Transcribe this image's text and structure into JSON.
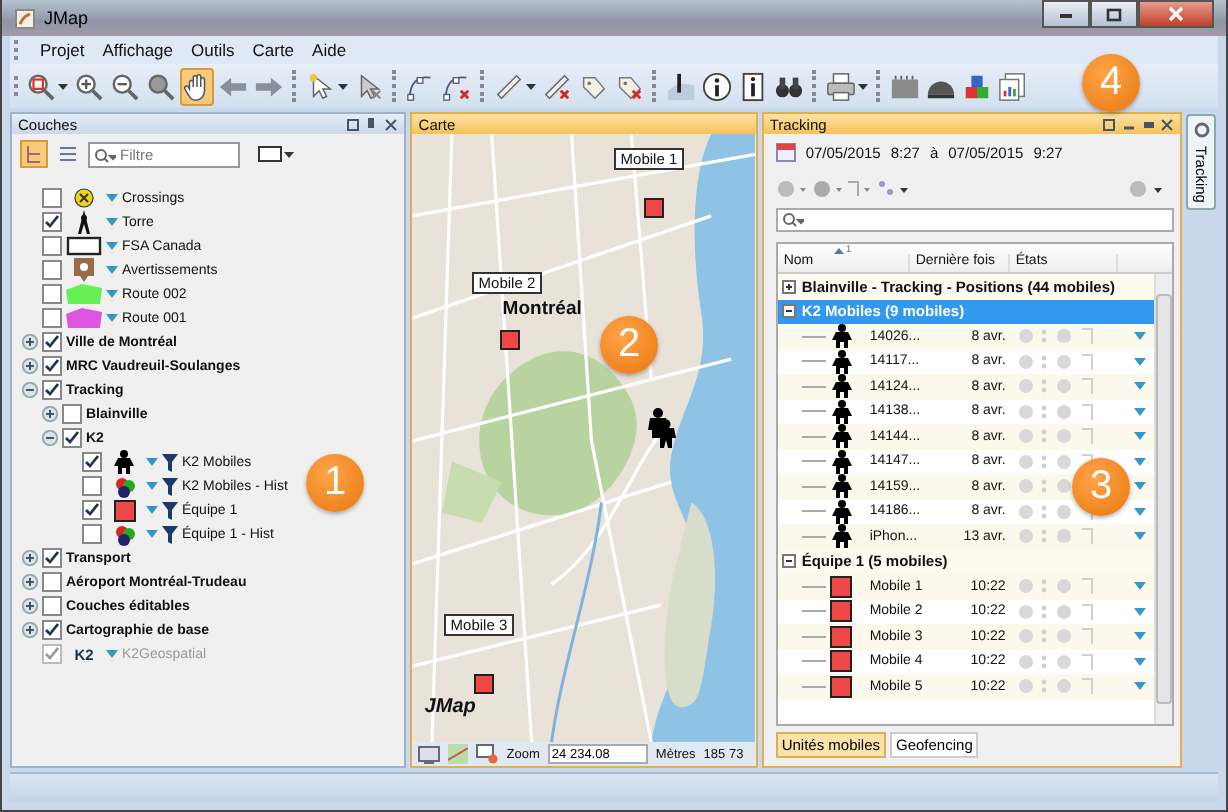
{
  "window": {
    "title": "JMap"
  },
  "menu": [
    "Projet",
    "Affichage",
    "Outils",
    "Carte",
    "Aide"
  ],
  "toolbar": [
    {
      "kind": "zoom-box",
      "menu": true,
      "selected": false
    },
    {
      "kind": "zoom-in",
      "selected": false
    },
    {
      "kind": "zoom-out",
      "selected": false
    },
    {
      "kind": "zoom",
      "selected": false
    },
    {
      "kind": "pan",
      "selected": true
    },
    {
      "kind": "back",
      "selected": false
    },
    {
      "kind": "forward",
      "selected": false
    },
    {
      "kind": "separator"
    },
    {
      "kind": "select",
      "menu": true,
      "selected": false
    },
    {
      "kind": "select-off",
      "selected": false
    },
    {
      "kind": "separator"
    },
    {
      "kind": "node",
      "selected": false
    },
    {
      "kind": "node-delete",
      "selected": false
    },
    {
      "kind": "separator"
    },
    {
      "kind": "measure",
      "menu": true,
      "selected": false
    },
    {
      "kind": "measure-delete",
      "selected": false
    },
    {
      "kind": "tag",
      "selected": false
    },
    {
      "kind": "tag-delete",
      "selected": false
    },
    {
      "kind": "separator"
    },
    {
      "kind": "info-chart",
      "selected": false
    },
    {
      "kind": "info",
      "selected": false
    },
    {
      "kind": "info-doc",
      "selected": false
    },
    {
      "kind": "binoculars",
      "selected": false
    },
    {
      "kind": "separator"
    },
    {
      "kind": "print",
      "menu": true,
      "selected": false
    },
    {
      "kind": "separator"
    },
    {
      "kind": "layout",
      "selected": false
    },
    {
      "kind": "helmet",
      "selected": false
    },
    {
      "kind": "shapes",
      "selected": false
    },
    {
      "kind": "report",
      "selected": false
    }
  ],
  "layers_panel": {
    "title": "Couches",
    "views": [
      {
        "kind": "tree",
        "selected": true
      },
      {
        "kind": "list",
        "selected": false
      }
    ],
    "search": {
      "placeholder": "Filtre"
    },
    "items": [
      {
        "label": "Crossings",
        "kind": "crossing",
        "checked": false
      },
      {
        "label": "Torre",
        "kind": "tower",
        "checked": true
      },
      {
        "label": "FSA Canada",
        "kind": "rectangle",
        "checked": false
      },
      {
        "label": "Avertissements",
        "kind": "warning",
        "checked": false
      },
      {
        "label": "Route 002",
        "kind": "area",
        "color": "#66ee55",
        "checked": false
      },
      {
        "label": "Route 001",
        "kind": "area",
        "color": "#dd55dd",
        "checked": false
      },
      {
        "label": "Ville de Montréal",
        "kind": "group",
        "checked": true,
        "expanded": false
      },
      {
        "label": "MRC Vaudreuil-Soulanges",
        "kind": "group",
        "checked": true,
        "expanded": false
      },
      {
        "label": "Tracking",
        "kind": "group",
        "checked": true,
        "expanded": true,
        "children": [
          {
            "label": "Blainville",
            "kind": "group",
            "checked": false,
            "expanded": false
          },
          {
            "label": "K2",
            "kind": "group",
            "checked": true,
            "expanded": true,
            "children": [
              {
                "label": "K2 Mobiles",
                "kind": "person",
                "filtered": true,
                "checked": true
              },
              {
                "label": "K2 Mobiles - Hist",
                "kind": "cluster",
                "filtered": true,
                "checked": false
              },
              {
                "label": "Équipe 1",
                "kind": "square",
                "filtered": true,
                "checked": true
              },
              {
                "label": "Équipe 1 - Hist",
                "kind": "cluster",
                "filtered": true,
                "checked": false
              }
            ]
          }
        ]
      },
      {
        "label": "Transport",
        "kind": "group",
        "checked": true,
        "expanded": false
      },
      {
        "label": "Aéroport Montréal-Trudeau",
        "kind": "group",
        "checked": false,
        "expanded": false
      },
      {
        "label": "Couches éditables",
        "kind": "group",
        "checked": false,
        "expanded": false
      },
      {
        "label": "Cartographie de base",
        "kind": "group",
        "checked": true,
        "expanded": false
      },
      {
        "label": "K2Geospatial",
        "kind": "logo",
        "logo_text": "K2",
        "checked": true,
        "disabled": true
      }
    ]
  },
  "map_panel": {
    "title": "Carte",
    "place_label": "Montréal",
    "markers": [
      {
        "label": "Mobile 1",
        "kind": "square"
      },
      {
        "label": "Mobile 2",
        "kind": "square"
      },
      {
        "label": "Mobile 3",
        "kind": "square"
      },
      {
        "kind": "people"
      }
    ],
    "logo": "JMap",
    "zoom_label": "Zoom",
    "zoom_value": "24 234.08",
    "unit": "Mètres",
    "scale": "185 73"
  },
  "tracking_panel": {
    "title": "Tracking",
    "date_from": "07/05/2015",
    "time_from": "8:27",
    "date_separator": "à",
    "date_to": "07/05/2015",
    "time_to": "9:27",
    "columns": [
      {
        "label": "Nom",
        "sort_rank": "1"
      },
      {
        "label": "Dernière fois"
      },
      {
        "label": "États"
      }
    ],
    "groups": [
      {
        "label": "Blainville - Tracking - Positions (44 mobiles)",
        "expanded": false,
        "selected": false
      },
      {
        "label": "K2 Mobiles (9 mobiles)",
        "expanded": true,
        "selected": true,
        "rows": [
          {
            "name": "14026...",
            "time": "8 avr.",
            "kind": "person"
          },
          {
            "name": "14117...",
            "time": "8 avr.",
            "kind": "person"
          },
          {
            "name": "14124...",
            "time": "8 avr.",
            "kind": "person"
          },
          {
            "name": "14138...",
            "time": "8 avr.",
            "kind": "person"
          },
          {
            "name": "14144...",
            "time": "8 avr.",
            "kind": "person"
          },
          {
            "name": "14147...",
            "time": "8 avr.",
            "kind": "person"
          },
          {
            "name": "14159...",
            "time": "8 avr.",
            "kind": "person"
          },
          {
            "name": "14186...",
            "time": "8 avr.",
            "kind": "person"
          },
          {
            "name": "iPhon...",
            "time": "13 avr.",
            "kind": "person"
          }
        ]
      },
      {
        "label": "Équipe 1 (5 mobiles)",
        "expanded": true,
        "selected": false,
        "rows": [
          {
            "name": "Mobile 1",
            "time": "10:22",
            "kind": "square"
          },
          {
            "name": "Mobile 2",
            "time": "10:22",
            "kind": "square"
          },
          {
            "name": "Mobile 3",
            "time": "10:22",
            "kind": "square"
          },
          {
            "name": "Mobile 4",
            "time": "10:22",
            "kind": "square"
          },
          {
            "name": "Mobile 5",
            "time": "10:22",
            "kind": "square"
          }
        ]
      }
    ],
    "tabs": [
      {
        "label": "Unités mobiles",
        "selected": true
      },
      {
        "label": "Geofencing",
        "selected": false
      }
    ]
  },
  "side_tabs": [
    "Tracking"
  ],
  "callouts": [
    "1",
    "2",
    "3",
    "4"
  ]
}
